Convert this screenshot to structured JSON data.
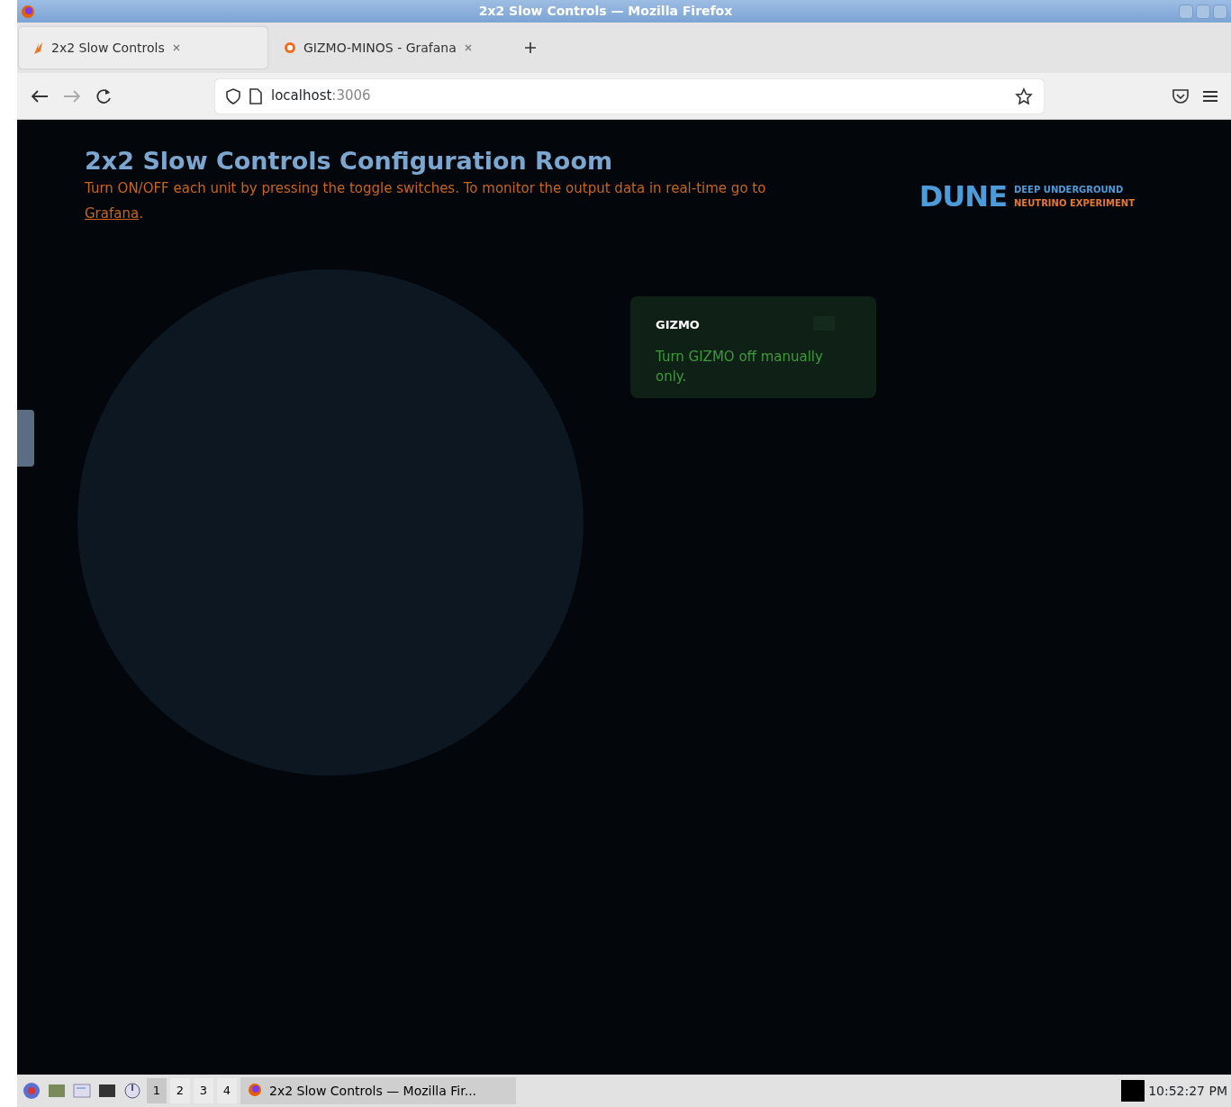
{
  "window": {
    "title": "2x2 Slow Controls — Mozilla Firefox"
  },
  "tabs": [
    {
      "label": "2x2 Slow Controls",
      "selected": true
    },
    {
      "label": "GIZMO-MINOS - Grafana",
      "selected": false
    }
  ],
  "address": {
    "host": "localhost",
    "port": ":3006"
  },
  "page": {
    "title": "2x2 Slow Controls Configuration Room",
    "description_before": "Turn ON/OFF each unit by pressing the toggle switches. To monitor the output data in real-time go to ",
    "link": "Grafana",
    "description_after": ".",
    "logo": {
      "word": "DUNE",
      "line_1": "DEEP UNDERGROUND",
      "line_2": "NEUTRINO EXPERIMENT"
    }
  },
  "toast": {
    "title": "GIZMO",
    "message": "Turn GIZMO off manually only."
  },
  "taskbar": {
    "workspaces": [
      {
        "label": "1",
        "selected": true
      },
      {
        "label": "2",
        "selected": false
      },
      {
        "label": "3",
        "selected": false
      },
      {
        "label": "4",
        "selected": false
      }
    ],
    "task": "2x2 Slow Controls — Mozilla Fir...",
    "clock": "10:52:27 PM"
  }
}
